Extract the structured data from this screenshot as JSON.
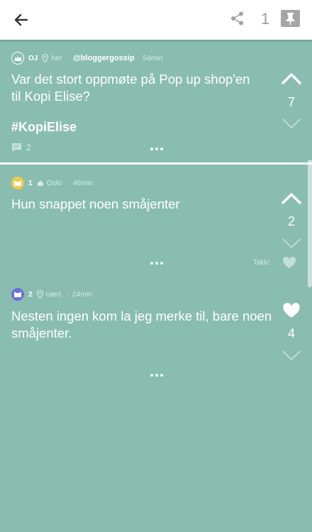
{
  "header": {
    "back_icon": "arrow-left-icon",
    "share_icon": "share-icon",
    "pin_count": "1",
    "pin_icon": "pin-icon"
  },
  "op": {
    "badge_icon": "crown-icon",
    "username": "OJ",
    "location": "her",
    "handle": "@bloggergossip",
    "time": "54min",
    "text": "Var det stort oppmøte på Pop up shop'en til Kopi Elise?",
    "hashtag": "#KopiElise",
    "comment_count": "2",
    "score": "7"
  },
  "replies": [
    {
      "badge_color": "#f2c94c",
      "badge_icon": "cat-icon",
      "number": "1",
      "location": "Oslo",
      "time": "46min",
      "text": "Hun snappet noen småjenter",
      "score": "2",
      "thanks_label": "Takk!"
    },
    {
      "badge_color": "#6b6fd8",
      "badge_icon": "cat-icon",
      "number": "2",
      "location": "nært",
      "time": "24min",
      "text": "Nesten ingen kom la jeg merke til, bare noen småjenter.",
      "score": "4"
    }
  ],
  "colors": {
    "background": "#89bdb0",
    "header": "#ffffff",
    "pin": "#a5a5a5"
  }
}
